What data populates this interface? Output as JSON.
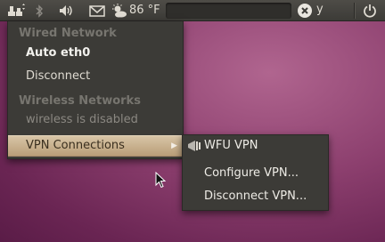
{
  "topbar": {
    "weather_temp": "86 °F",
    "user_name": "y",
    "icons": [
      "network-icon",
      "bluetooth-icon",
      "volume-icon",
      "mail-icon",
      "weather-icon",
      "user-status-icon",
      "power-icon"
    ]
  },
  "network_menu": {
    "wired_header": "Wired Network",
    "wired_connection": "Auto eth0",
    "disconnect": "Disconnect",
    "wireless_header": "Wireless Networks",
    "wireless_status": "wireless is disabled",
    "vpn_connections": "VPN Connections",
    "arrow": "▶"
  },
  "vpn_submenu": {
    "items": [
      {
        "label": "WFU VPN",
        "icon": "vpn-lock-icon"
      },
      {
        "label": "Configure VPN..."
      },
      {
        "label": "Disconnect VPN..."
      }
    ]
  },
  "colors": {
    "panel": "#3c3b37",
    "highlight": "#c9b28f",
    "desktop": "#8c3f6e"
  }
}
